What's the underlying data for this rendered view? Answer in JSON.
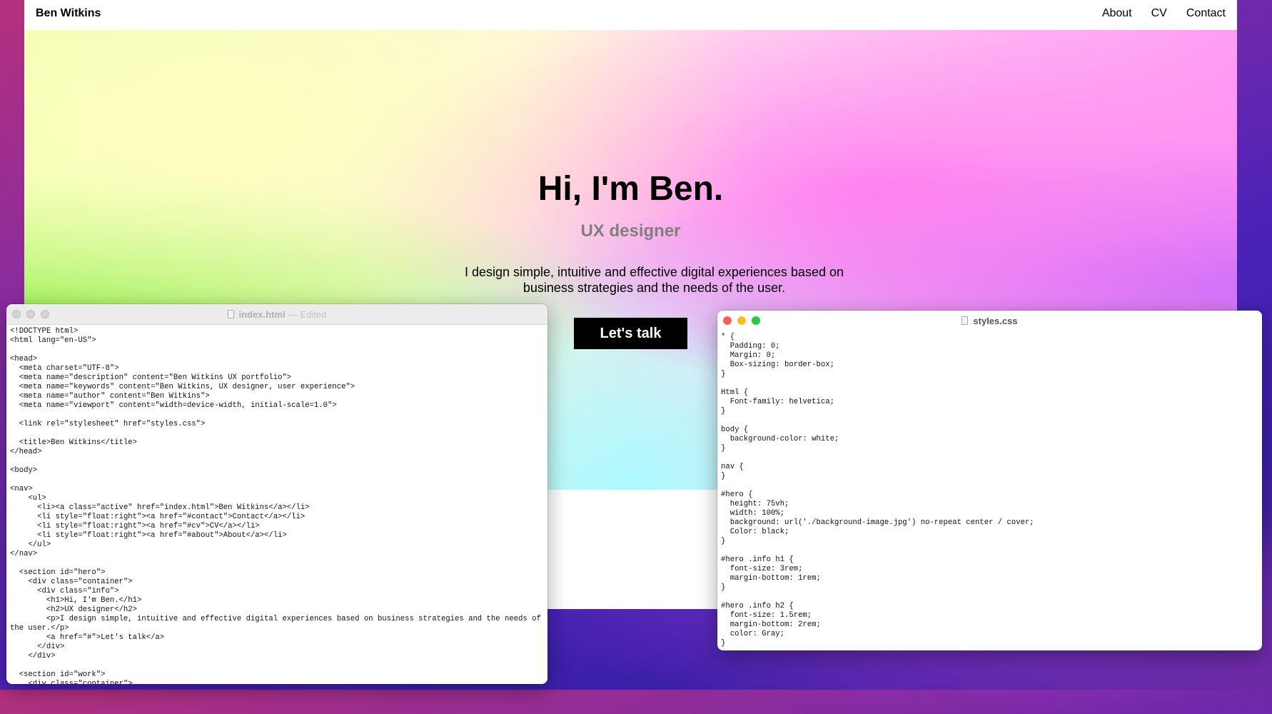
{
  "site": {
    "brand": "Ben Witkins",
    "nav": [
      "About",
      "CV",
      "Contact"
    ],
    "hero_title": "Hi, I'm Ben.",
    "hero_subtitle": "UX designer",
    "hero_description": "I design simple, intuitive and effective digital experiences based on business strategies and the needs of the user.",
    "cta_label": "Let's talk"
  },
  "html_editor": {
    "filename": "index.html",
    "separator": "—",
    "status": "Edited",
    "code": "<!DOCTYPE html>\n<html lang=\"en-US\">\n\n<head>\n  <meta charset=\"UTF-8\">\n  <meta name=\"description\" content=\"Ben Witkins UX portfolio\">\n  <meta name=\"keywords\" content=\"Ben Witkins, UX designer, user experience\">\n  <meta name=\"author\" content=\"Ben Witkins\">\n  <meta name=\"viewport\" content=\"width=device-width, initial-scale=1.0\">\n\n  <link rel=\"stylesheet\" href=\"styles.css\">\n\n  <title>Ben Witkins</title>\n</head>\n\n<body>\n\n<nav>\n    <ul>\n      <li><a class=\"active\" href=\"index.html\">Ben Witkins</a></li>\n      <li style=\"float:right\"><a href=\"#contact\">Contact</a></li>\n      <li style=\"float:right\"><a href=\"#cv\">CV</a></li>\n      <li style=\"float:right\"><a href=\"#about\">About</a></li>\n    </ul>\n</nav>\n\n  <section id=\"hero\">\n    <div class=\"container\">\n      <div class=\"info\">\n        <h1>Hi, I'm Ben.</h1>\n        <h2>UX designer</h2>\n        <p>I design simple, intuitive and effective digital experiences based on business strategies and the needs of the user.</p>\n        <a href=\"#\">Let's talk</a>\n      </div>\n    </div>\n\n  <section id=\"work\">\n    <div class=\"container\">"
  },
  "css_editor": {
    "filename": "styles.css",
    "code": "* {\n  Padding: 0;\n  Margin: 0;\n  Box-sizing: border-box;\n}\n\nHtml {\n  Font-family: helvetica;\n}\n\nbody {\n  background-color: white;\n}\n\nnav {\n}\n\n#hero {\n  height: 75vh;\n  width: 100%;\n  background: url('./background-image.jpg') no-repeat center / cover;\n  Color: black;\n}\n\n#hero .info h1 {\n  font-size: 3rem;\n  margin-bottom: 1rem;\n}\n\n#hero .info h2 {\n  font-size: 1.5rem;\n  margin-bottom: 2rem;\n  color: Gray;\n}"
  }
}
